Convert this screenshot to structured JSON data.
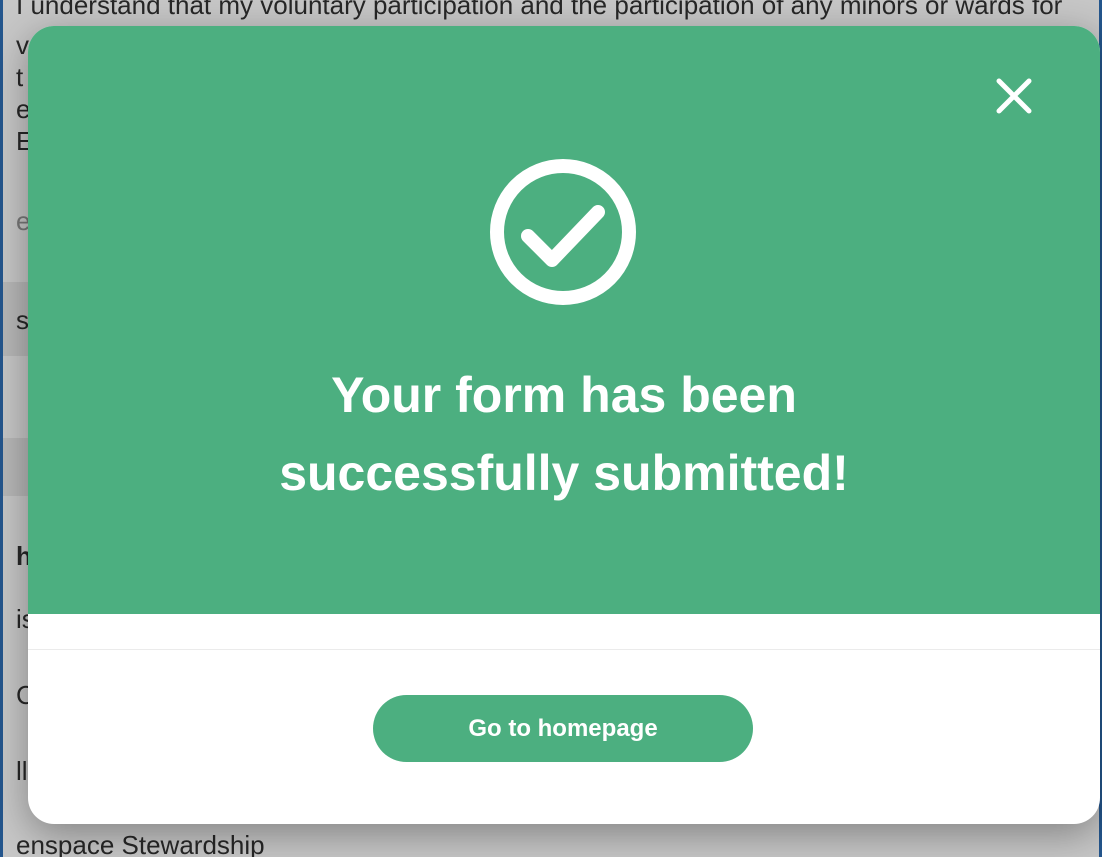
{
  "background_page": {
    "lines": [
      "I understand that my voluntary participation and the participation of any minors or wards for",
      "ve",
      "t",
      "e",
      "EX",
      "e",
      "s",
      "h",
      "is",
      "Ce",
      "ll",
      "enspace Stewardship"
    ]
  },
  "modal": {
    "close_icon": "close-icon",
    "success_icon": "check-circle-icon",
    "title_line1": "Your form has been",
    "title_line2": "successfully submitted!",
    "button_label": "Go to homepage",
    "colors": {
      "accent": "#4caf80",
      "text_on_accent": "#ffffff",
      "surface": "#ffffff"
    }
  }
}
